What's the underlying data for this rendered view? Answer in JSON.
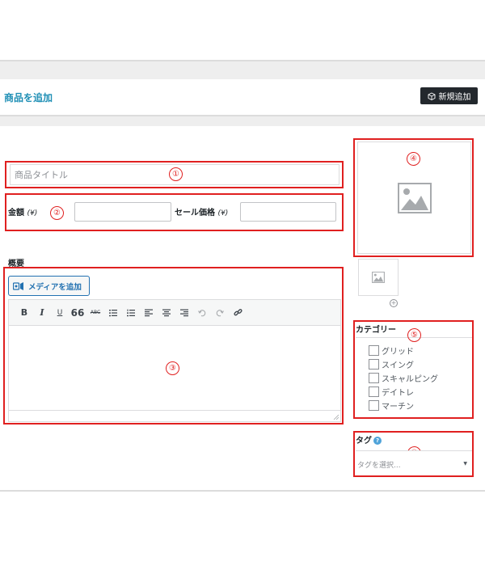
{
  "header": {
    "title": "商品を追加",
    "new_button_label": "新規追加"
  },
  "form": {
    "title_placeholder": "商品タイトル",
    "price_label": "金額",
    "price_unit": "(¥)",
    "sale_price_label": "セール価格",
    "sale_price_unit": "(¥)",
    "summary_label": "概要",
    "media_button_label": "メディアを追加",
    "toolbar": [
      "B",
      "I",
      "U",
      "66",
      "ABC",
      "bullet-list",
      "number-list",
      "align-left",
      "align-center",
      "align-right",
      "undo",
      "redo",
      "link"
    ]
  },
  "sidebar": {
    "category_title": "カテゴリー",
    "categories": [
      "グリッド",
      "スイング",
      "スキャルピング",
      "デイトレ",
      "マーチン"
    ],
    "tag_title": "タグ",
    "tag_placeholder": "タグを選択..."
  },
  "annotations": [
    "①",
    "②",
    "③",
    "④",
    "⑤",
    "⑥"
  ],
  "colors": {
    "accent": "#1f8fb5",
    "annotation_red": "#e02020",
    "button_dark": "#23282d",
    "link_blue": "#2271b1"
  }
}
